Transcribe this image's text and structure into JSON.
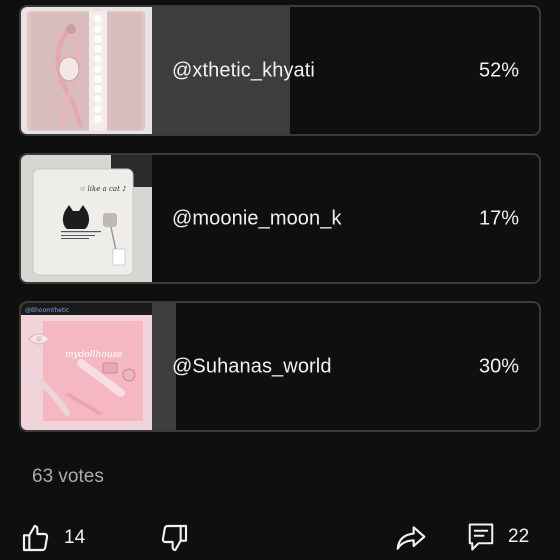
{
  "poll": {
    "options": [
      {
        "name": "@xthetic_khyati",
        "percent": "52%",
        "fraction": 0.52,
        "image": "pink-notebook-with-lace-ribbon"
      },
      {
        "name": "@moonie_moon_k",
        "percent": "17%",
        "fraction": 0.17,
        "image": "white-cat-notebook"
      },
      {
        "name": "@Suhanas_world",
        "percent": "30%",
        "fraction": 0.3,
        "image": "pink-diary-with-bows"
      }
    ],
    "total_votes": "63 votes",
    "image_caption": "@Bhoomthetic",
    "notebook_text": "mydollhouse"
  },
  "actions": {
    "like_count": "14",
    "comment_count": "22",
    "icons": [
      "thumbs-up-icon",
      "thumbs-down-icon",
      "share-icon",
      "comment-icon"
    ]
  },
  "colors": {
    "background": "#0f0f0f",
    "bar_fill": "#3d3d3d",
    "border": "#3a3a3a",
    "text": "#f1f1f1",
    "muted": "#aaaaaa"
  }
}
